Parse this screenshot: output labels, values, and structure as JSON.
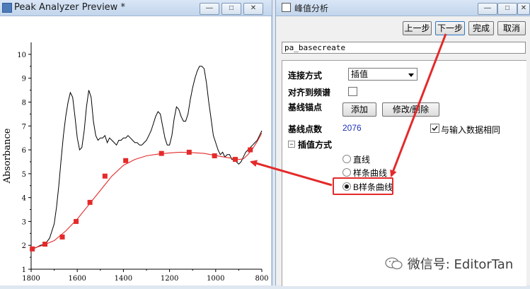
{
  "left_window": {
    "title": "Peak Analyzer Preview *",
    "btn_min": "—",
    "btn_max": "□",
    "btn_close": "✕"
  },
  "right_window": {
    "title": "峰值分析",
    "btn_min": "—",
    "btn_max": "□",
    "btn_close": "✕",
    "buttons": {
      "prev": "上一步",
      "next": "下一步",
      "finish": "完成",
      "cancel": "取消"
    },
    "command": "pa_basecreate",
    "connect_label": "连接方式",
    "connect_value": "插值",
    "align_label": "对齐到频谱",
    "anchor_label": "基线锚点",
    "add_button": "添加",
    "modify_button": "修改/删除",
    "points_label": "基线点数",
    "points_value": "2076",
    "same_as_input": "与输入数据相同",
    "interp_label": "插值方式",
    "interp_options": [
      "直线",
      "样条曲线",
      "B样条曲线"
    ],
    "interp_selected": "B样条曲线"
  },
  "watermark": "微信号: EditorTan",
  "colors": {
    "annotation": "#e42a2a",
    "baseline": "#e42a2a",
    "spectrum": "#000000"
  },
  "chart_data": {
    "type": "line",
    "title": "",
    "xlabel": "",
    "ylabel": "Absorbance",
    "xlim": [
      1800,
      800
    ],
    "ylim": [
      1,
      10.5
    ],
    "xticks": [
      1800,
      1600,
      1400,
      1200,
      1000,
      800
    ],
    "yticks": [
      1,
      2,
      3,
      4,
      5,
      6,
      7,
      8,
      9,
      10
    ],
    "series": [
      {
        "kind": "spectrum",
        "x": [
          1800,
          1780,
          1760,
          1740,
          1720,
          1700,
          1690,
          1680,
          1670,
          1660,
          1650,
          1640,
          1630,
          1620,
          1610,
          1600,
          1590,
          1580,
          1570,
          1560,
          1550,
          1540,
          1530,
          1520,
          1510,
          1500,
          1490,
          1480,
          1470,
          1460,
          1450,
          1440,
          1430,
          1420,
          1410,
          1400,
          1390,
          1380,
          1370,
          1360,
          1350,
          1340,
          1330,
          1320,
          1310,
          1300,
          1290,
          1280,
          1270,
          1260,
          1250,
          1240,
          1230,
          1220,
          1210,
          1200,
          1190,
          1180,
          1170,
          1160,
          1150,
          1140,
          1130,
          1120,
          1110,
          1100,
          1090,
          1080,
          1070,
          1060,
          1050,
          1040,
          1030,
          1020,
          1010,
          1000,
          990,
          980,
          970,
          960,
          950,
          940,
          930,
          920,
          910,
          900,
          890,
          880,
          870,
          860,
          850,
          840,
          830,
          820,
          810,
          800
        ],
        "y": [
          1.85,
          1.9,
          2.0,
          2.05,
          2.3,
          2.9,
          3.6,
          4.5,
          5.6,
          6.6,
          7.4,
          8.0,
          8.4,
          8.2,
          7.4,
          6.5,
          6.0,
          6.1,
          6.8,
          7.8,
          8.5,
          8.2,
          7.2,
          6.6,
          6.4,
          6.5,
          6.5,
          6.6,
          6.3,
          6.5,
          6.4,
          6.3,
          6.2,
          6.4,
          6.4,
          6.5,
          6.5,
          6.6,
          6.5,
          6.4,
          6.3,
          6.3,
          6.2,
          6.2,
          6.3,
          6.4,
          6.6,
          6.8,
          7.1,
          7.4,
          7.6,
          7.5,
          7.0,
          6.5,
          6.2,
          6.2,
          6.6,
          7.3,
          7.8,
          7.7,
          7.4,
          7.2,
          7.2,
          7.5,
          8.1,
          8.6,
          9.0,
          9.3,
          9.5,
          9.5,
          9.4,
          8.8,
          8.0,
          7.3,
          6.6,
          6.3,
          6.0,
          5.8,
          5.9,
          5.7,
          5.8,
          5.8,
          5.6,
          5.6,
          5.5,
          5.4,
          5.5,
          5.7,
          5.9,
          6.0,
          6.1,
          6.2,
          6.3,
          6.4,
          6.6,
          6.8
        ]
      },
      {
        "kind": "baseline",
        "x": [
          1800,
          1750,
          1700,
          1650,
          1600,
          1550,
          1500,
          1450,
          1400,
          1350,
          1300,
          1250,
          1200,
          1150,
          1100,
          1050,
          1000,
          950,
          900,
          880,
          860,
          840,
          820,
          800
        ],
        "y": [
          1.85,
          2.0,
          2.2,
          2.6,
          3.1,
          3.7,
          4.3,
          4.9,
          5.35,
          5.6,
          5.75,
          5.82,
          5.87,
          5.9,
          5.88,
          5.85,
          5.76,
          5.68,
          5.6,
          5.62,
          5.8,
          6.05,
          6.35,
          6.7
        ]
      }
    ],
    "markers": {
      "x": [
        1795,
        1740,
        1665,
        1605,
        1545,
        1480,
        1390,
        1235,
        1115,
        1005,
        915,
        850
      ],
      "y": [
        1.85,
        2.05,
        2.35,
        3.0,
        3.8,
        4.9,
        5.55,
        5.85,
        5.9,
        5.75,
        5.6,
        6.0
      ]
    }
  }
}
